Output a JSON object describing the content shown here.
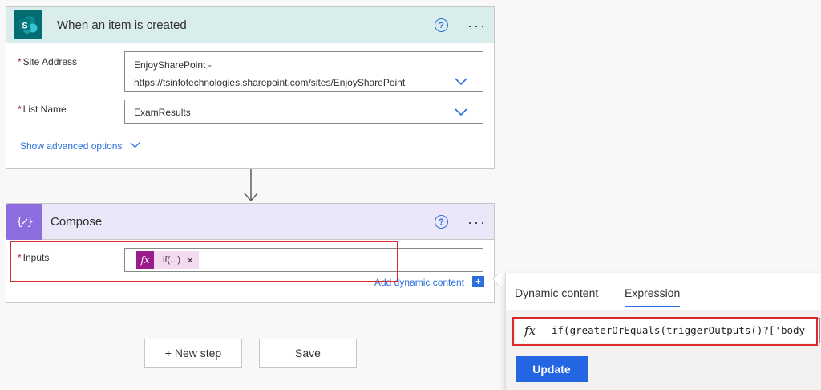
{
  "trigger_card": {
    "title": "When an item is created",
    "help_glyph": "?",
    "more_glyph": "···",
    "site_address": {
      "label": "Site Address",
      "value_line1": "EnjoySharePoint -",
      "value_line2": "https://tsinfotechnologies.sharepoint.com/sites/EnjoySharePoint"
    },
    "list_name": {
      "label": "List Name",
      "value": "ExamResults"
    },
    "advanced_link": "Show advanced options",
    "required_mark": "*"
  },
  "compose_card": {
    "title": "Compose",
    "help_glyph": "?",
    "more_glyph": "···",
    "inputs": {
      "label": "Inputs",
      "token_text": "if(...)",
      "token_remove": "×"
    },
    "add_dynamic_link": "Add dynamic content",
    "add_dynamic_glyph": "+"
  },
  "actions": {
    "new_step": "+ New step",
    "save": "Save"
  },
  "panel": {
    "tabs": [
      {
        "label": "Dynamic content",
        "active": false
      },
      {
        "label": "Expression",
        "active": true
      }
    ],
    "fx_glyph": "fx",
    "expression": "if(greaterOrEquals(triggerOutputs()?['body",
    "update_button": "Update"
  },
  "colors": {
    "sharepoint_teal": "#036c70",
    "compose_purple": "#8c6cdf",
    "link_blue": "#2b6fdc",
    "update_blue": "#2266e3",
    "highlight_red": "#d92b2b",
    "token_magenta": "#9c1b8c"
  }
}
